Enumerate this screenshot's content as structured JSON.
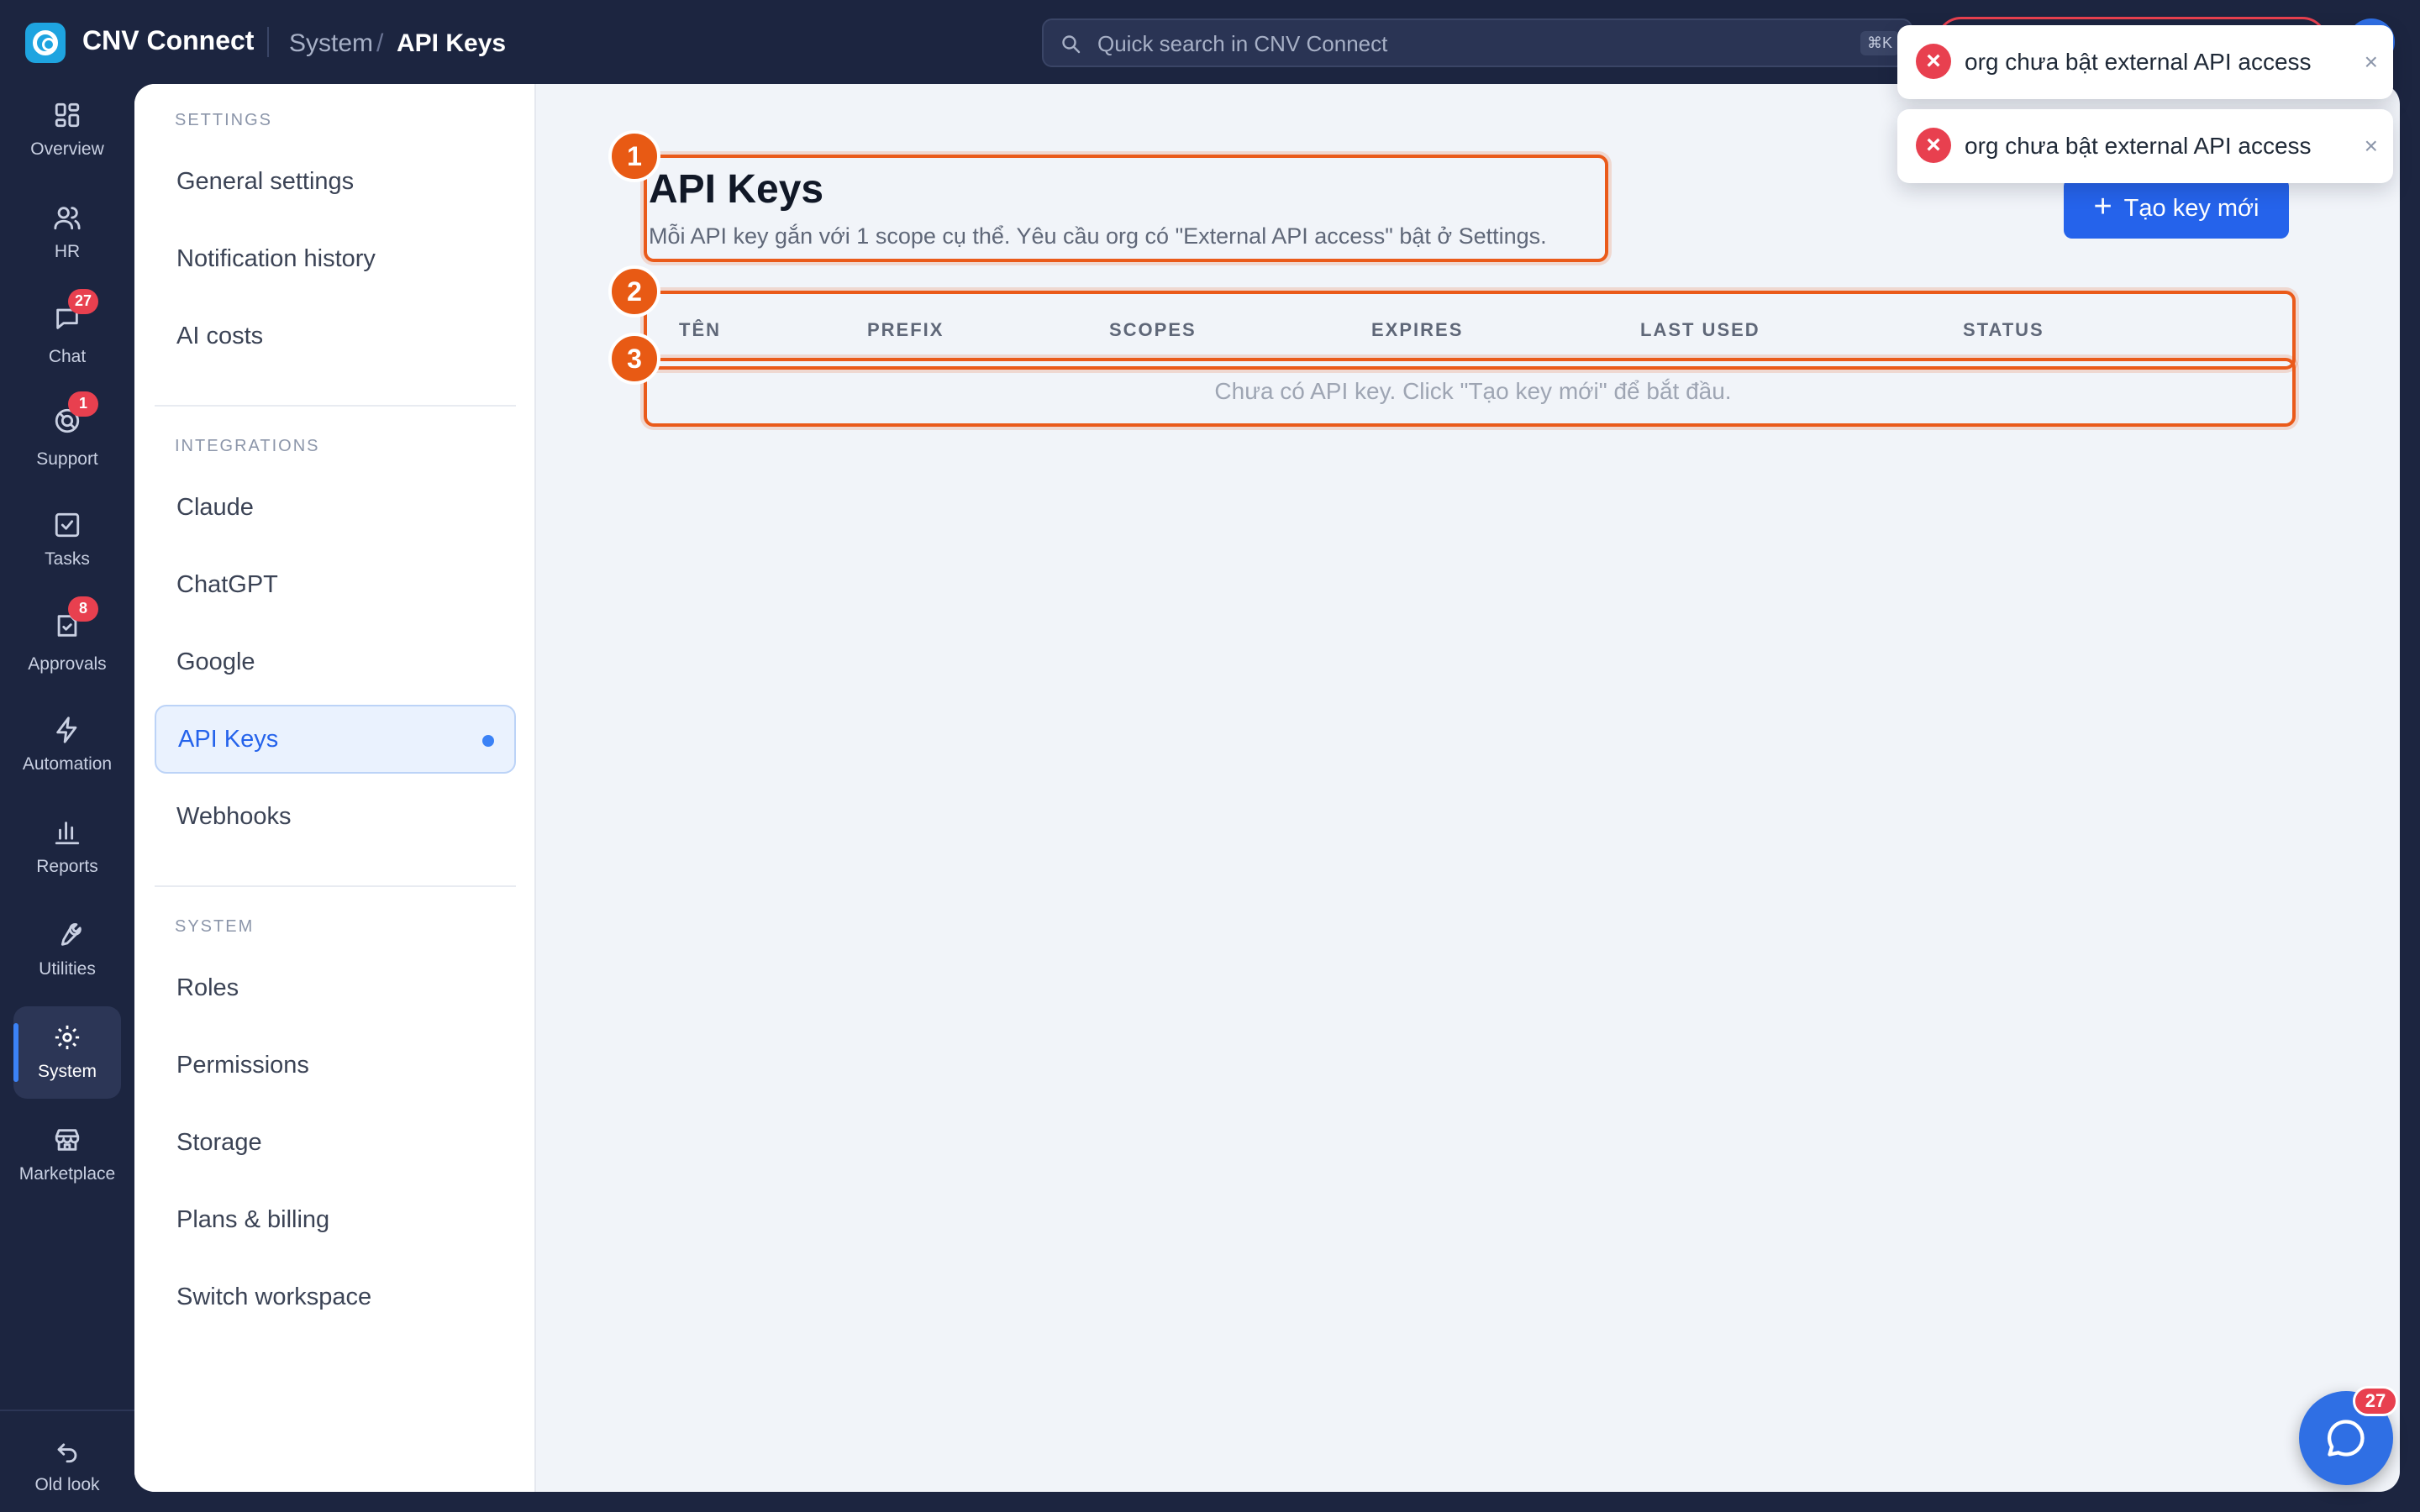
{
  "app": {
    "title": "CNV Connect"
  },
  "breadcrumb": {
    "section": "System",
    "separator": "/",
    "current": "API Keys"
  },
  "search": {
    "placeholder": "Quick search in CNV Connect",
    "shortcut": "⌘K"
  },
  "rail": {
    "items": [
      {
        "label": "Overview",
        "icon": "grid-icon"
      },
      {
        "label": "HR",
        "icon": "users-icon"
      },
      {
        "label": "Chat",
        "icon": "chat-icon",
        "badge": "27"
      },
      {
        "label": "Support",
        "icon": "support-icon",
        "badge": "1"
      },
      {
        "label": "Tasks",
        "icon": "checkbox-icon"
      },
      {
        "label": "Approvals",
        "icon": "approval-icon",
        "badge": "8"
      },
      {
        "label": "Automation",
        "icon": "bolt-icon"
      },
      {
        "label": "Reports",
        "icon": "bar-chart-icon"
      },
      {
        "label": "Utilities",
        "icon": "wrench-icon"
      },
      {
        "label": "System",
        "icon": "gear-icon",
        "active": true
      },
      {
        "label": "Marketplace",
        "icon": "store-icon"
      }
    ],
    "old_look": "Old look"
  },
  "settings_nav": {
    "sections": [
      {
        "title": "SETTINGS",
        "items": [
          "General settings",
          "Notification history",
          "AI costs"
        ]
      },
      {
        "title": "INTEGRATIONS",
        "items": [
          "Claude",
          "ChatGPT",
          "Google",
          "API Keys",
          "Webhooks"
        ]
      },
      {
        "title": "SYSTEM",
        "items": [
          "Roles",
          "Permissions",
          "Storage",
          "Plans & billing",
          "Switch workspace"
        ]
      }
    ],
    "active_item": "API Keys"
  },
  "page": {
    "title": "API Keys",
    "description": "Mỗi API key gắn với 1 scope cụ thể. Yêu cầu org có \"External API access\" bật ở Settings.",
    "create_button": "Tạo key mới",
    "create_button_icon": "plus-icon"
  },
  "table": {
    "columns": [
      "TÊN",
      "PREFIX",
      "SCOPES",
      "EXPIRES",
      "LAST USED",
      "STATUS"
    ],
    "empty_message": "Chưa có API key. Click \"Tạo key mới\" để bắt đầu."
  },
  "annotations": [
    "1",
    "2",
    "3"
  ],
  "toasts": [
    {
      "message": "org chưa bật external API access",
      "close": "×"
    },
    {
      "message": "org chưa bật external API access",
      "close": "×"
    }
  ],
  "chat_fab": {
    "badge": "27"
  },
  "colors": {
    "accent": "#2563eb",
    "sidebar": "#1c2540",
    "annotation": "#e85a14",
    "error": "#e8404f"
  }
}
